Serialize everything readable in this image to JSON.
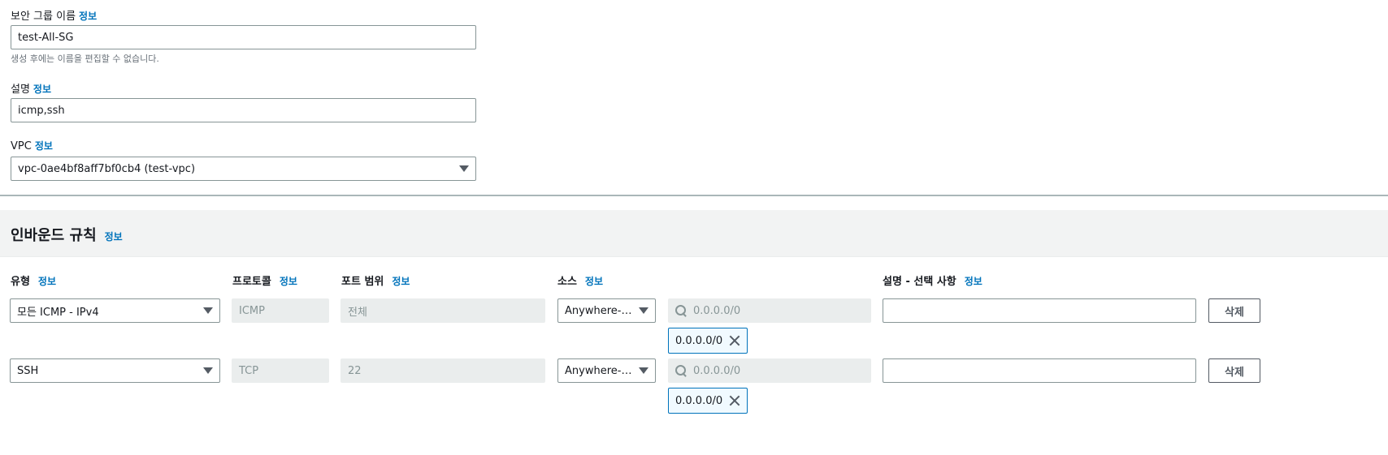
{
  "sg_name": {
    "label": "보안 그룹 이름",
    "info": "정보",
    "value": "test-All-SG",
    "hint": "생성 후에는 이름을 편집할 수 없습니다."
  },
  "description": {
    "label": "설명",
    "info": "정보",
    "value": "icmp,ssh"
  },
  "vpc": {
    "label": "VPC",
    "info": "정보",
    "value": "vpc-0ae4bf8aff7bf0cb4 (test-vpc)"
  },
  "inbound": {
    "title": "인바운드 규칙",
    "info": "정보",
    "columns": {
      "type": "유형",
      "protocol": "프로토콜",
      "port_range": "포트 범위",
      "source": "소스",
      "desc": "설명 - 선택 사항",
      "info": "정보"
    },
    "rules": [
      {
        "type": "모든 ICMP - IPv4",
        "protocol": "ICMP",
        "port_range": "전체",
        "source_type": "Anywhere-I...",
        "source_search_placeholder": "0.0.0.0/0",
        "source_token": "0.0.0.0/0",
        "desc": "",
        "delete_label": "삭제"
      },
      {
        "type": "SSH",
        "protocol": "TCP",
        "port_range": "22",
        "source_type": "Anywhere-I...",
        "source_search_placeholder": "0.0.0.0/0",
        "source_token": "0.0.0.0/0",
        "desc": "",
        "delete_label": "삭제"
      }
    ]
  }
}
